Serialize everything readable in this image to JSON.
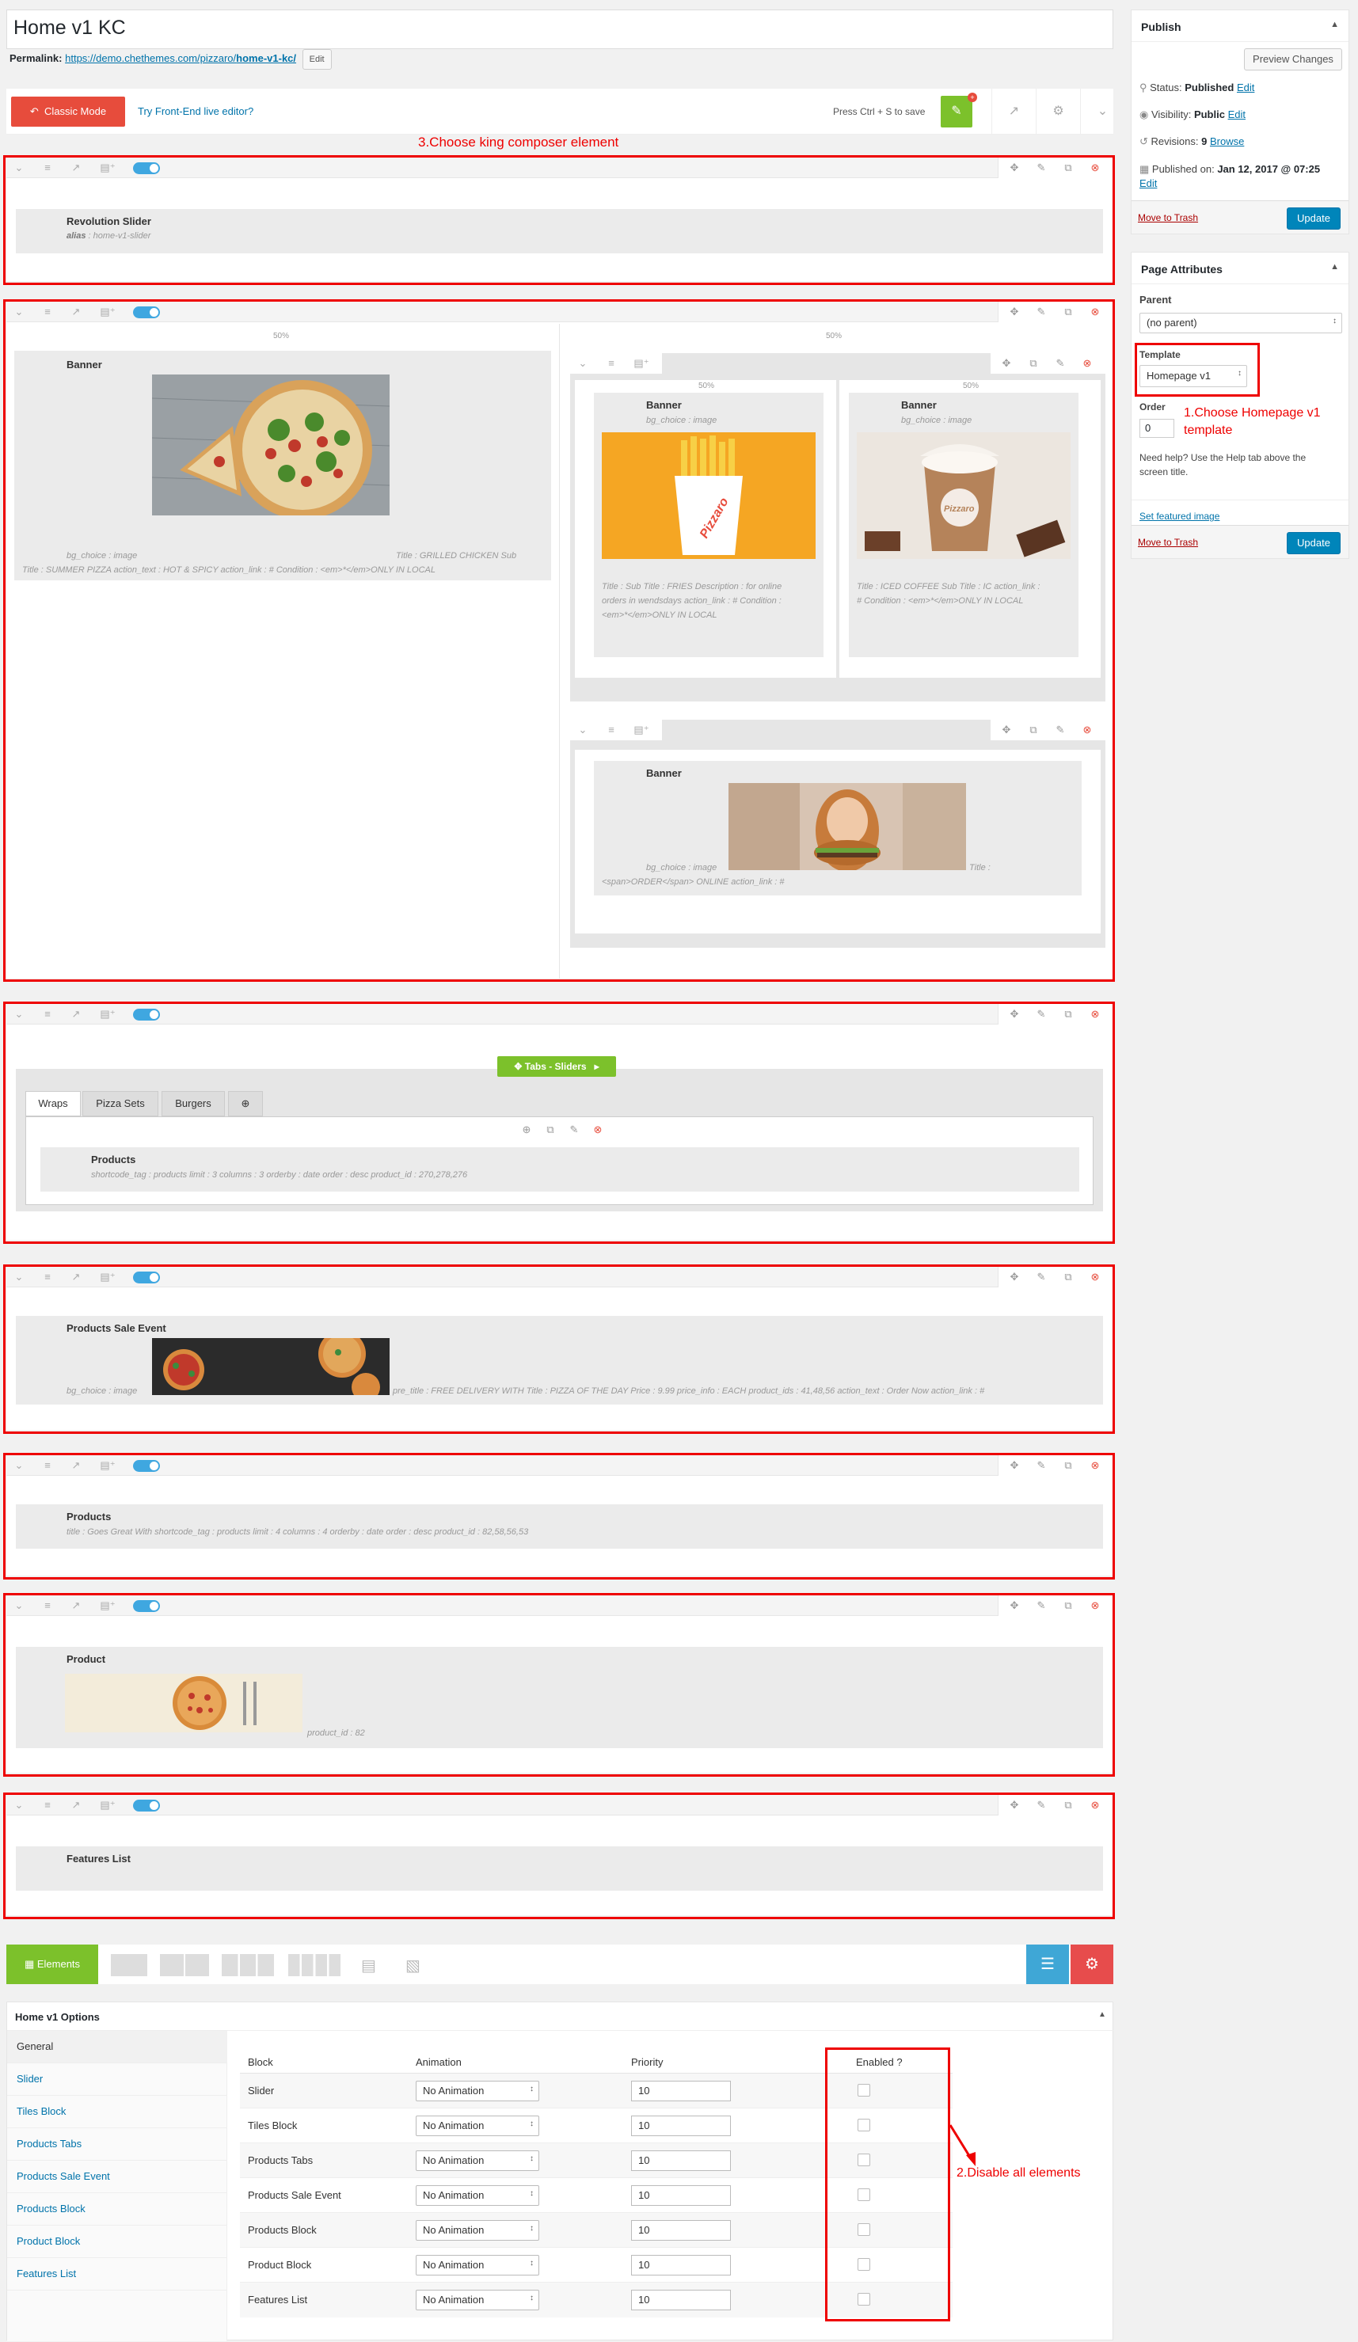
{
  "page": {
    "title": "Home v1 KC",
    "permalink_label": "Permalink:",
    "permalink_base": "https://demo.chethemes.com/pizzaro/",
    "permalink_slug": "home-v1-kc/",
    "permalink_edit": "Edit"
  },
  "kc_toolbar": {
    "classic_mode": "Classic Mode",
    "frontend_link": "Try Front-End live editor?",
    "save_hint": "Press Ctrl + S to save",
    "badge": "+"
  },
  "annotations": {
    "choose_element": "3.Choose  king  composer element",
    "choose_template_1": "1.Choose Homepage v1",
    "choose_template_2": "template",
    "disable_all": "2.Disable all elements"
  },
  "rows": {
    "revolution": {
      "title": "Revolution Slider",
      "meta_key": "alias",
      "meta_val": " : home-v1-slider"
    },
    "banner_main": {
      "pct": "50%",
      "title": "Banner",
      "meta_1": "bg_choice : image",
      "meta_2": "Title : GRILLED CHICKEN  Sub",
      "meta_3": "Title : SUMMER PIZZA  action_text : HOT & SPICY  action_link : #  Condition : <em>*</em>ONLY IN LOCAL"
    },
    "banner_right_pct": "50%",
    "banner_fries": {
      "pct": "50%",
      "title": "Banner",
      "bg": "bg_choice : image",
      "meta_1": "Title :  Sub Title : FRIES  Description : for online",
      "meta_2": "orders in wendsdays  action_link : #  Condition :",
      "meta_3": "<em>*</em>ONLY IN LOCAL",
      "img_text": "Pizzaro"
    },
    "banner_coffee": {
      "pct": "50%",
      "title": "Banner",
      "bg": "bg_choice : image",
      "meta_1": "Title : ICED COFFEE  Sub Title : IC  action_link :",
      "meta_2": "#  Condition : <em>*</em>ONLY IN LOCAL",
      "img_text": "Pizzaro"
    },
    "banner_burger": {
      "title": "Banner",
      "meta_1": "bg_choice : image",
      "meta_2": "Title :",
      "meta_3": "<span>ORDER</span> ONLINE  action_link : #"
    },
    "tabs": {
      "header": "Tabs - Sliders",
      "tab_1": "Wraps",
      "tab_2": "Pizza Sets",
      "tab_3": "Burgers",
      "tab_add": "⊕",
      "el_title": "Products",
      "el_meta": "shortcode_tag : products  limit : 3  columns : 3  orderby : date  order : desc  product_id : 270,278,276"
    },
    "sale_event": {
      "title": "Products Sale Event",
      "meta_1": "bg_choice : image",
      "meta_2": "pre_title : FREE DELIVERY WITH  Title : PIZZA OF THE DAY  Price : 9.99  price_info : EACH  product_ids : 41,48,56  action_text : Order Now  action_link : #"
    },
    "products_block": {
      "title": "Products",
      "meta": "title : Goes Great With  shortcode_tag : products  limit : 4  columns : 4  orderby : date  order : desc  product_id : 82,58,56,53"
    },
    "product_block": {
      "title": "Product",
      "meta": "product_id : 82"
    },
    "features": {
      "title": "Features List"
    }
  },
  "bottom_bar": {
    "elements": "Elements"
  },
  "publish": {
    "heading": "Publish",
    "preview": "Preview Changes",
    "status_label": "Status:",
    "status_value": "Published",
    "visibility_label": "Visibility:",
    "visibility_value": "Public",
    "revisions_label": "Revisions:",
    "revisions_value": "9",
    "browse": "Browse",
    "published_label": "Published on:",
    "published_value": "Jan 12, 2017 @ 07:25",
    "edit": "Edit",
    "trash": "Move to Trash",
    "update": "Update"
  },
  "attributes": {
    "heading": "Page Attributes",
    "parent_label": "Parent",
    "parent_value": "(no parent)",
    "template_label": "Template",
    "template_value": "Homepage v1",
    "order_label": "Order",
    "order_value": "0",
    "help_1": "Need help? Use the Help tab above the",
    "help_2": "screen title.",
    "featured": "Set featured image",
    "trash": "Move to Trash",
    "update": "Update"
  },
  "options": {
    "heading": "Home v1 Options",
    "nav": [
      "General",
      "Slider",
      "Tiles Block",
      "Products Tabs",
      "Products Sale Event",
      "Products Block",
      "Product Block",
      "Features List"
    ],
    "col_block": "Block",
    "col_animation": "Animation",
    "col_priority": "Priority",
    "col_enabled": "Enabled ?",
    "rows": [
      {
        "block": "Slider",
        "animation": "No Animation",
        "priority": "10"
      },
      {
        "block": "Tiles Block",
        "animation": "No Animation",
        "priority": "10"
      },
      {
        "block": "Products Tabs",
        "animation": "No Animation",
        "priority": "10"
      },
      {
        "block": "Products Sale Event",
        "animation": "No Animation",
        "priority": "10"
      },
      {
        "block": "Products Block",
        "animation": "No Animation",
        "priority": "10"
      },
      {
        "block": "Product Block",
        "animation": "No Animation",
        "priority": "10"
      },
      {
        "block": "Features List",
        "animation": "No Animation",
        "priority": "10"
      }
    ]
  },
  "colors": {
    "accent_red": "#e74c3c",
    "accent_green": "#7cc12b",
    "accent_blue": "#0085ba",
    "annotation_red": "#ee0000"
  }
}
